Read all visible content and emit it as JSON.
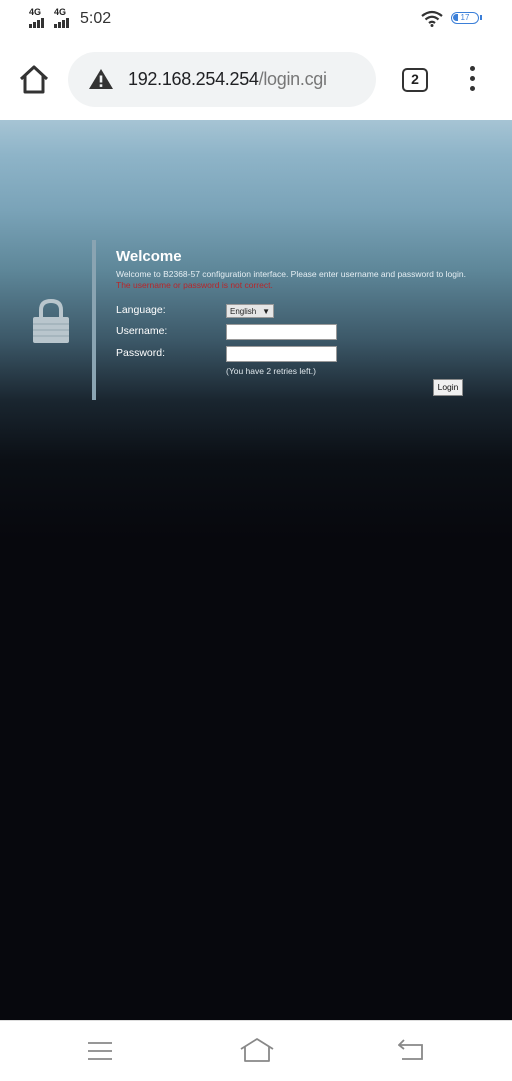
{
  "status_bar": {
    "signal1": "4G",
    "signal2": "4G",
    "time": "5:02",
    "battery_level": "17",
    "wifi_icon": "wifi-icon"
  },
  "browser": {
    "url_host": "192.168.254.254",
    "url_path": "/login.cgi",
    "tab_count": "2",
    "icons": [
      "home-icon",
      "warning-icon",
      "tabs-icon",
      "overflow-menu-icon"
    ]
  },
  "login": {
    "title": "Welcome",
    "description": "Welcome to B2368-57 configuration interface. Please enter username and password to login.",
    "error": "The username or password is not correct.",
    "language_label": "Language:",
    "language_value": "English",
    "username_label": "Username:",
    "username_value": "",
    "password_label": "Password:",
    "password_value": "",
    "retries_text": "(You have 2 retries left.)",
    "login_button": "Login"
  },
  "nav": {
    "icons": [
      "menu-icon",
      "home-icon",
      "back-icon"
    ]
  },
  "colors": {
    "error": "#b8262a",
    "battery": "#3b7fd8",
    "page_bg": "#07080d"
  }
}
